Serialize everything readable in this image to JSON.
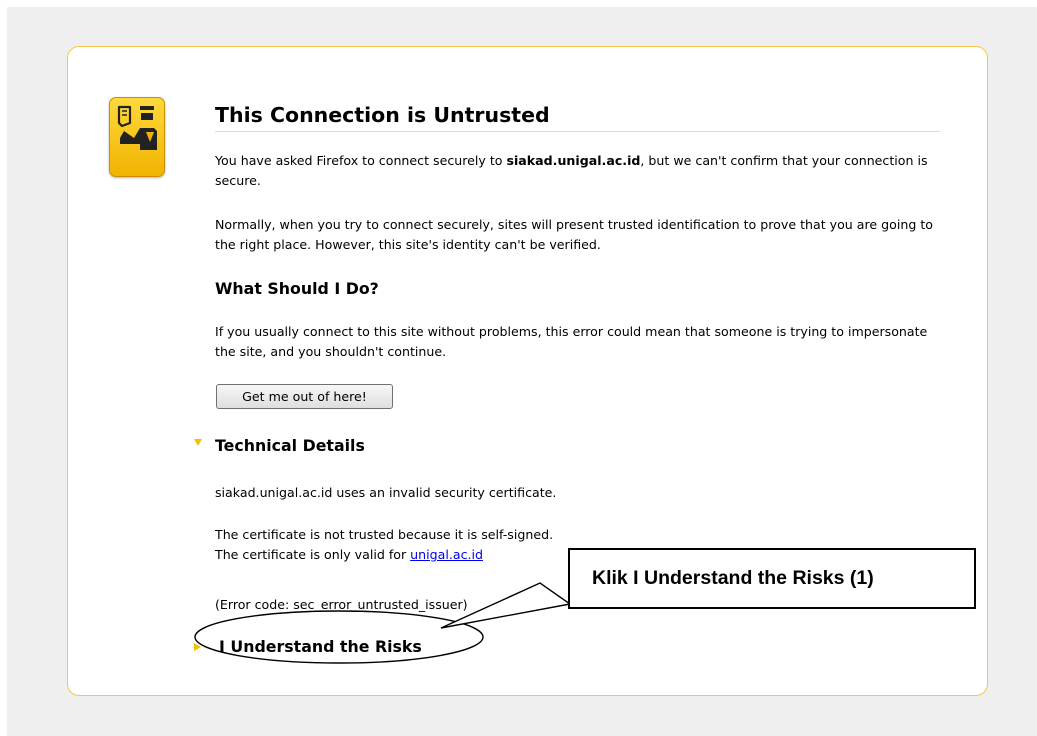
{
  "page": {
    "title": "This Connection is Untrusted",
    "intro": {
      "before": "You have asked Firefox to connect securely to ",
      "host": "siakad.unigal.ac.id",
      "after": ", but we can't confirm that your connection is secure."
    },
    "explanation": "Normally, when you try to connect securely, sites will present trusted identification to prove that you are going to the right place. However, this site's identity can't be verified.",
    "what_heading": "What Should I Do?",
    "what_text": "If you usually connect to this site without problems, this error could mean that someone is trying to impersonate the site, and you shouldn't continue.",
    "get_out_button": "Get me out of here!"
  },
  "technical": {
    "heading": "Technical Details",
    "line1": "siakad.unigal.ac.id uses an invalid security certificate.",
    "line2": "The certificate is not trusted because it is self-signed.",
    "line3_prefix": "The certificate is only valid for ",
    "line3_link": "unigal.ac.id",
    "error_code": "(Error code: sec_error_untrusted_issuer)"
  },
  "risks": {
    "heading": "I Understand the Risks"
  },
  "annotation": {
    "callout": "Klik I Understand the Risks (1)"
  },
  "icons": {
    "certificate": "security-officer-icon",
    "tech_expander": "expanded-triangle-icon",
    "risk_expander": "collapsed-triangle-icon"
  },
  "colors": {
    "accent": "#f3c74a",
    "link": "#0000ee",
    "background": "#efefef"
  }
}
